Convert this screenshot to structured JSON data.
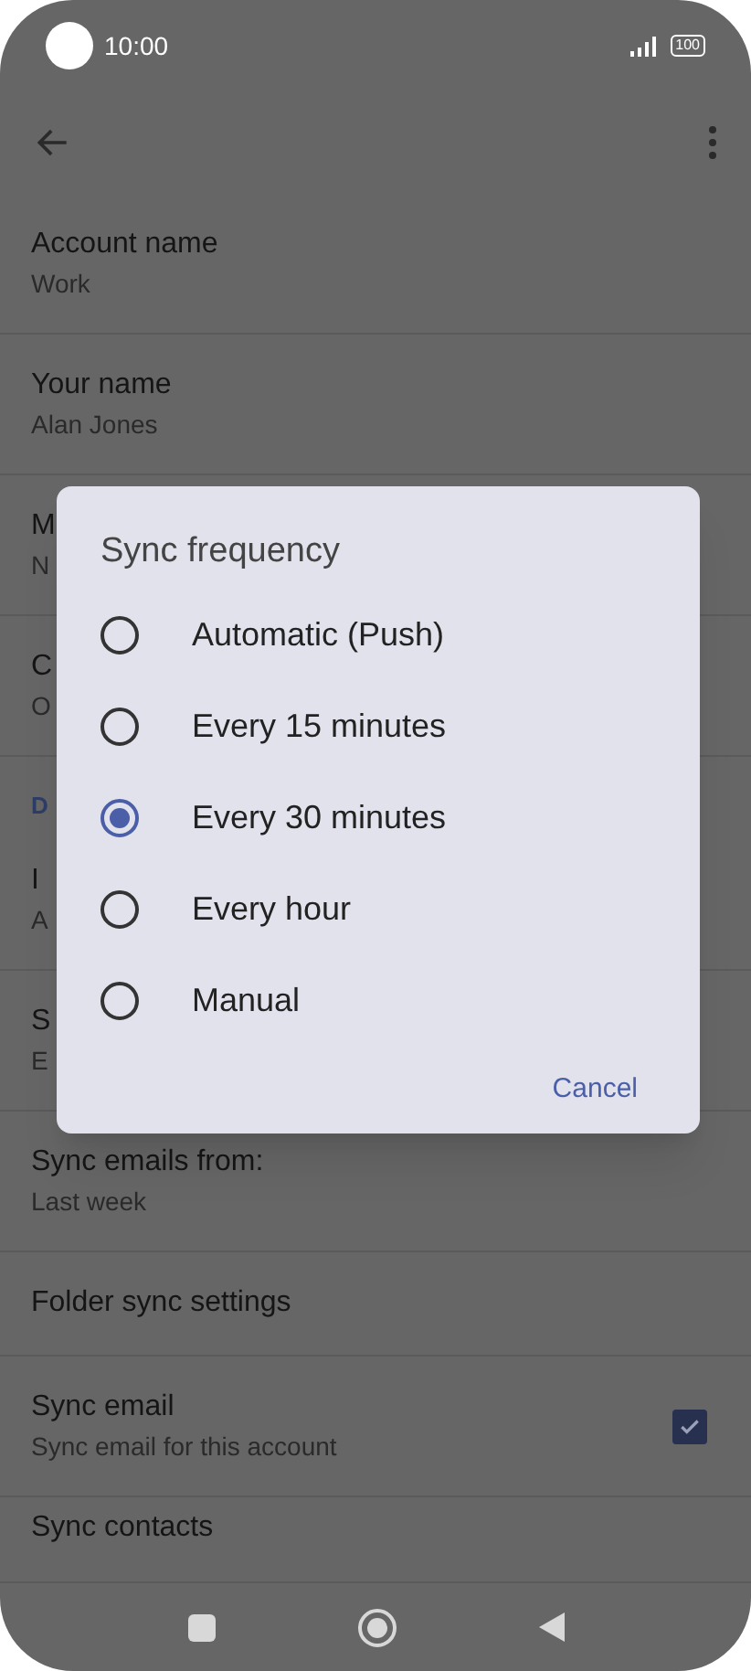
{
  "status_bar": {
    "time": "10:00",
    "battery": "100"
  },
  "settings": [
    {
      "kind": "two_line",
      "title": "Account name",
      "subtitle": "Work"
    },
    {
      "kind": "two_line",
      "title": "Your name",
      "subtitle": "Alan Jones"
    },
    {
      "kind": "two_line",
      "title": "M",
      "subtitle": "N"
    },
    {
      "kind": "two_line",
      "title": "C",
      "subtitle": "O"
    },
    {
      "kind": "header",
      "title": "D"
    },
    {
      "kind": "two_line",
      "title": "I",
      "subtitle": "A"
    },
    {
      "kind": "two_line",
      "title": "S",
      "subtitle": "E"
    },
    {
      "kind": "two_line",
      "title": "Sync emails from:",
      "subtitle": "Last week"
    },
    {
      "kind": "one_line",
      "title": "Folder sync settings"
    },
    {
      "kind": "checkbox",
      "title": "Sync email",
      "subtitle": "Sync email for this account",
      "checked": true
    },
    {
      "kind": "cut",
      "title": "Sync contacts"
    }
  ],
  "dialog": {
    "title": "Sync frequency",
    "options": [
      {
        "label": "Automatic (Push)",
        "selected": false
      },
      {
        "label": "Every 15 minutes",
        "selected": false
      },
      {
        "label": "Every 30 minutes",
        "selected": true
      },
      {
        "label": "Every hour",
        "selected": false
      },
      {
        "label": "Manual",
        "selected": false
      }
    ],
    "button": "Cancel"
  }
}
